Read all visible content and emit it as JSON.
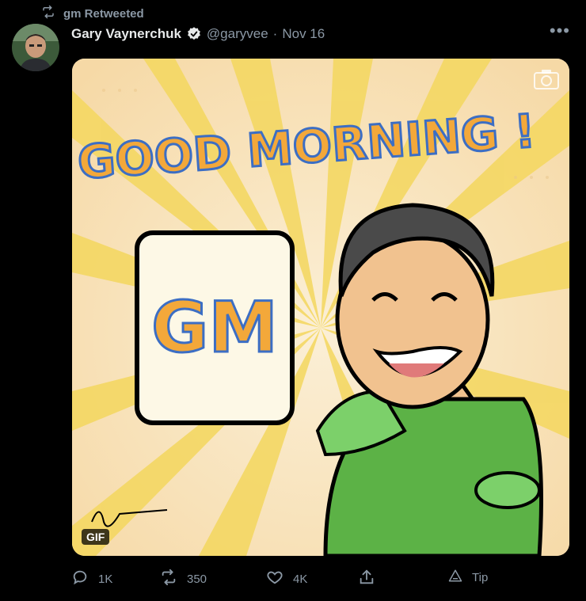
{
  "retweet_context": {
    "label": "gm Retweeted"
  },
  "author": {
    "name": "Gary Vaynerchuk",
    "handle": "@garyvee",
    "separator": "·",
    "date": "Nov 16"
  },
  "menu": {
    "icon": "more-icon",
    "label": "•••"
  },
  "media": {
    "headline": "GOOD MORNING !",
    "mug_text": "GM",
    "badge": "GIF",
    "colors": {
      "sky": "#f9e6c3",
      "rays": "#f3d35a",
      "text": "#f3a83a",
      "text_outline": "#3c6ec4",
      "shirt": "#5cb246",
      "mug": "#fdf8e6"
    }
  },
  "actions": {
    "reply": {
      "icon": "reply-icon",
      "count": "1K"
    },
    "retweet": {
      "icon": "retweet-icon",
      "count": "350"
    },
    "like": {
      "icon": "heart-icon",
      "count": "4K"
    },
    "share": {
      "icon": "share-icon"
    },
    "tip": {
      "icon": "tip-icon",
      "label": "Tip"
    }
  }
}
